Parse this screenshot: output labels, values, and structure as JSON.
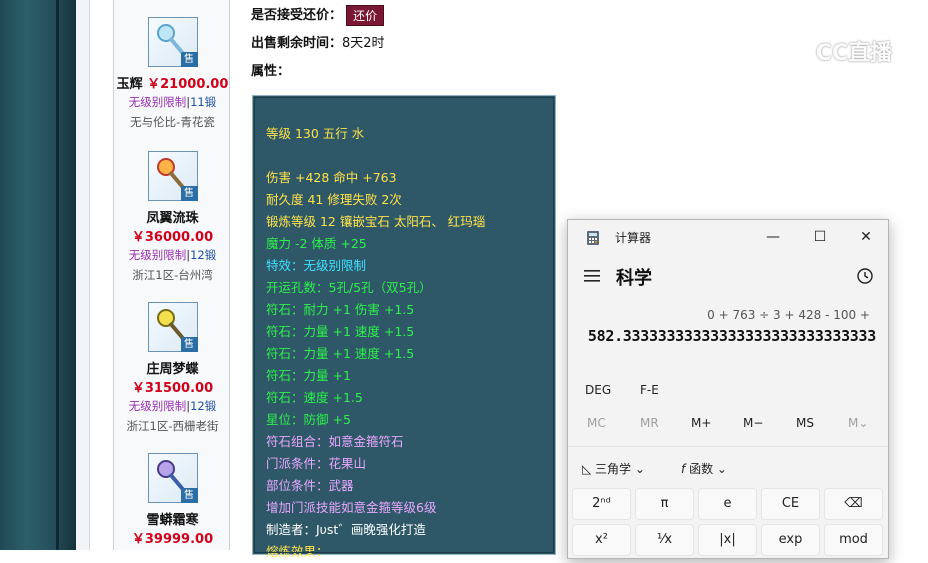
{
  "listing": {
    "items": [
      {
        "name": "玉辉",
        "price": "￥21000.00",
        "limit": "无级别限制",
        "sep": "|",
        "forge": "11锻",
        "server": "无与伦比-青花瓷",
        "sale": "售",
        "icon": "staff-icon"
      },
      {
        "name": "凤翼流珠",
        "price": "￥36000.00",
        "limit": "无级别限制",
        "sep": "|",
        "forge": "12锻",
        "server": "浙江1区-台州湾",
        "sale": "售",
        "icon": "staff-icon"
      },
      {
        "name": "庄周梦蝶",
        "price": "￥31500.00",
        "limit": "无级别限制",
        "sep": "|",
        "forge": "12锻",
        "server": "浙江1区-西栅老街",
        "sale": "售",
        "icon": "staff-icon"
      },
      {
        "name": "雪蟒霜寒",
        "price": "￥39999.00",
        "limit": "",
        "sep": "",
        "forge": "",
        "server": "",
        "sale": "售",
        "icon": "staff-icon"
      }
    ]
  },
  "detail": {
    "bargain_label": "是否接受还价：",
    "bargain_button": "还价",
    "time_label": "出售剩余时间：",
    "time_value": "8天2时",
    "attr_label": "属性："
  },
  "attributes": [
    {
      "text": "等级 130 五行 水",
      "color": "yellow"
    },
    {
      "text": "",
      "color": "yellow"
    },
    {
      "text": "伤害 +428 命中 +763",
      "color": "yellow"
    },
    {
      "text": "耐久度 41 修理失败 2次",
      "color": "yellow"
    },
    {
      "text": "锻炼等级 12 镶嵌宝石 太阳石、 红玛瑙",
      "color": "yellow"
    },
    {
      "text": "魔力 -2 体质 +25",
      "color": "lime"
    },
    {
      "text": "特效：无级别限制",
      "color": "cyan"
    },
    {
      "text": "开运孔数：5孔/5孔（双5孔）",
      "color": "lime"
    },
    {
      "text": "符石：耐力 +1 伤害 +1.5",
      "color": "lime"
    },
    {
      "text": "符石：力量 +1 速度 +1.5",
      "color": "lime"
    },
    {
      "text": "符石：力量 +1 速度 +1.5",
      "color": "lime"
    },
    {
      "text": "符石：力量 +1",
      "color": "lime"
    },
    {
      "text": "符石：速度 +1.5",
      "color": "lime"
    },
    {
      "text": "星位：防御 +5",
      "color": "lime"
    },
    {
      "text": "符石组合：如意金箍符石",
      "color": "pink"
    },
    {
      "text": "门派条件：花果山",
      "color": "pink"
    },
    {
      "text": "部位条件：武器",
      "color": "pink"
    },
    {
      "text": "增加门派技能如意金箍等级6级",
      "color": "pink"
    },
    {
      "text": "制造者：Jυѕt゛画晚强化打造",
      "color": "white"
    },
    {
      "text": "熔炼效果：",
      "color": "yellow"
    }
  ],
  "watermark": "CC直播",
  "calculator": {
    "title": "计算器",
    "mode": "科学",
    "expression": "0 + 763 ÷ 3 + 428 - 100 +",
    "result": "582.33333333333333333333333333333",
    "deg": "DEG",
    "fe": "F-E",
    "memory": [
      "MC",
      "MR",
      "M+",
      "M−",
      "MS",
      "M⌄"
    ],
    "trig": "三角学",
    "func": "函数",
    "keys": [
      "2ⁿᵈ",
      "π",
      "e",
      "CE",
      "⌫",
      "x²",
      "¹⁄x",
      "|x|",
      "exp",
      "mod"
    ]
  },
  "colors": {
    "yellow": "#ffe24a",
    "lime": "#2df14a",
    "cyan": "#3fe0ff",
    "pink": "#e9a7ff",
    "white": "#ffffff",
    "price": "#d0021b",
    "bargain": "#7a1732",
    "panel": "#2e5868"
  }
}
